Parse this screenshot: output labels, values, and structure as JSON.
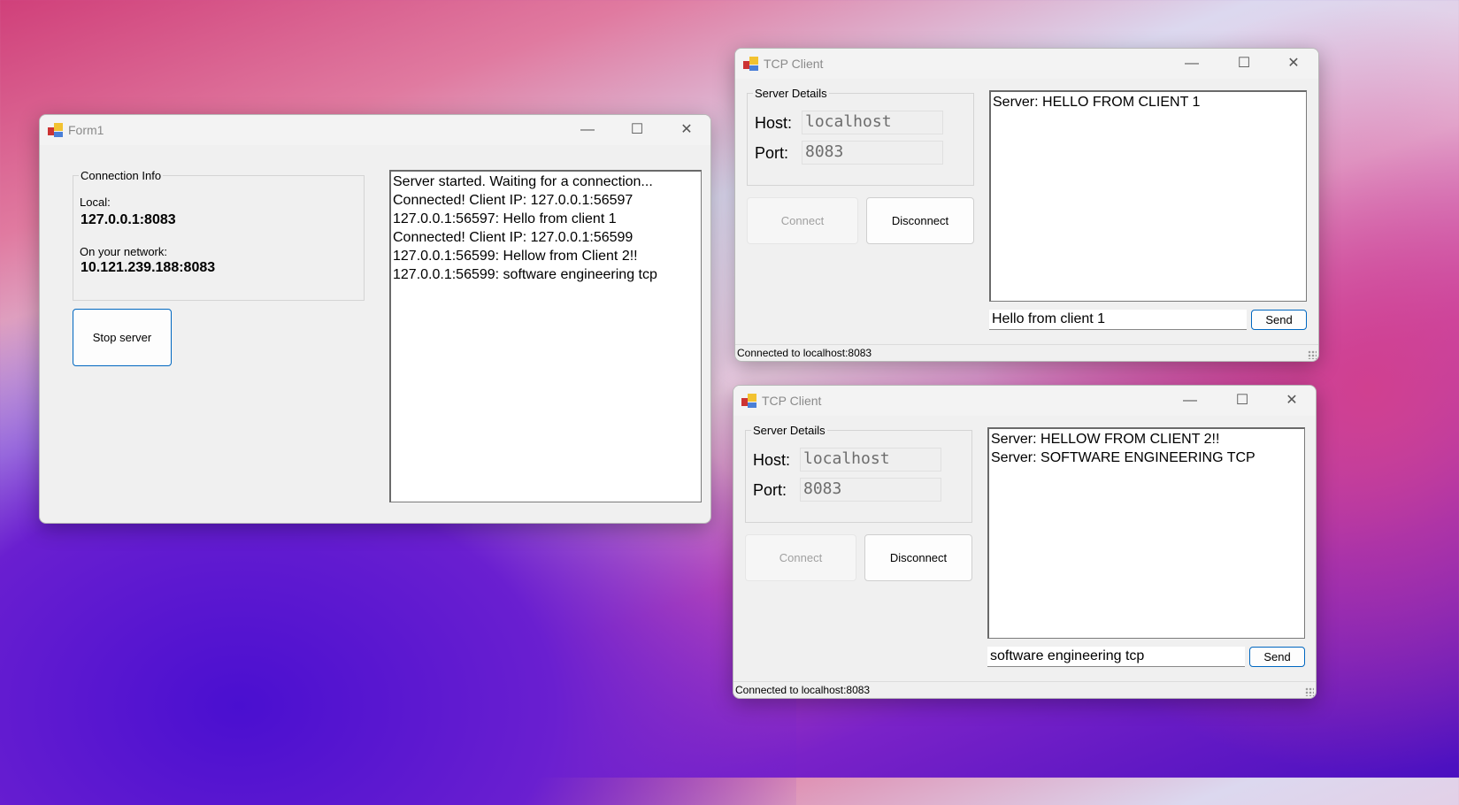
{
  "server_window": {
    "title": "Form1",
    "group_label": "Connection Info",
    "local_label": "Local:",
    "local_value": "127.0.0.1:8083",
    "network_label": "On your network:",
    "network_value": "10.121.239.188:8083",
    "stop_button": "Stop server",
    "log": [
      "Server started. Waiting for a connection...",
      "Connected! Client IP: 127.0.0.1:56597",
      "127.0.0.1:56597: Hello from client 1",
      "Connected! Client IP: 127.0.0.1:56599",
      "127.0.0.1:56599: Hellow from Client 2!!",
      "127.0.0.1:56599: software engineering tcp"
    ]
  },
  "clients": [
    {
      "title": "TCP Client",
      "group_label": "Server Details",
      "host_label": "Host:",
      "host_value": "localhost",
      "port_label": "Port:",
      "port_value": "8083",
      "connect": "Connect",
      "disconnect": "Disconnect",
      "log": [
        "Server: HELLO FROM CLIENT 1"
      ],
      "message": "Hello from client 1",
      "send": "Send",
      "status": "Connected to localhost:8083"
    },
    {
      "title": "TCP Client",
      "group_label": "Server Details",
      "host_label": "Host:",
      "host_value": "localhost",
      "port_label": "Port:",
      "port_value": "8083",
      "connect": "Connect",
      "disconnect": "Disconnect",
      "log": [
        "Server: HELLOW FROM CLIENT 2!!",
        "Server: SOFTWARE ENGINEERING TCP"
      ],
      "message": "software engineering tcp",
      "send": "Send",
      "status": "Connected to localhost:8083"
    }
  ],
  "window_controls": {
    "minimize": "—",
    "maximize": "☐",
    "close": "✕"
  }
}
